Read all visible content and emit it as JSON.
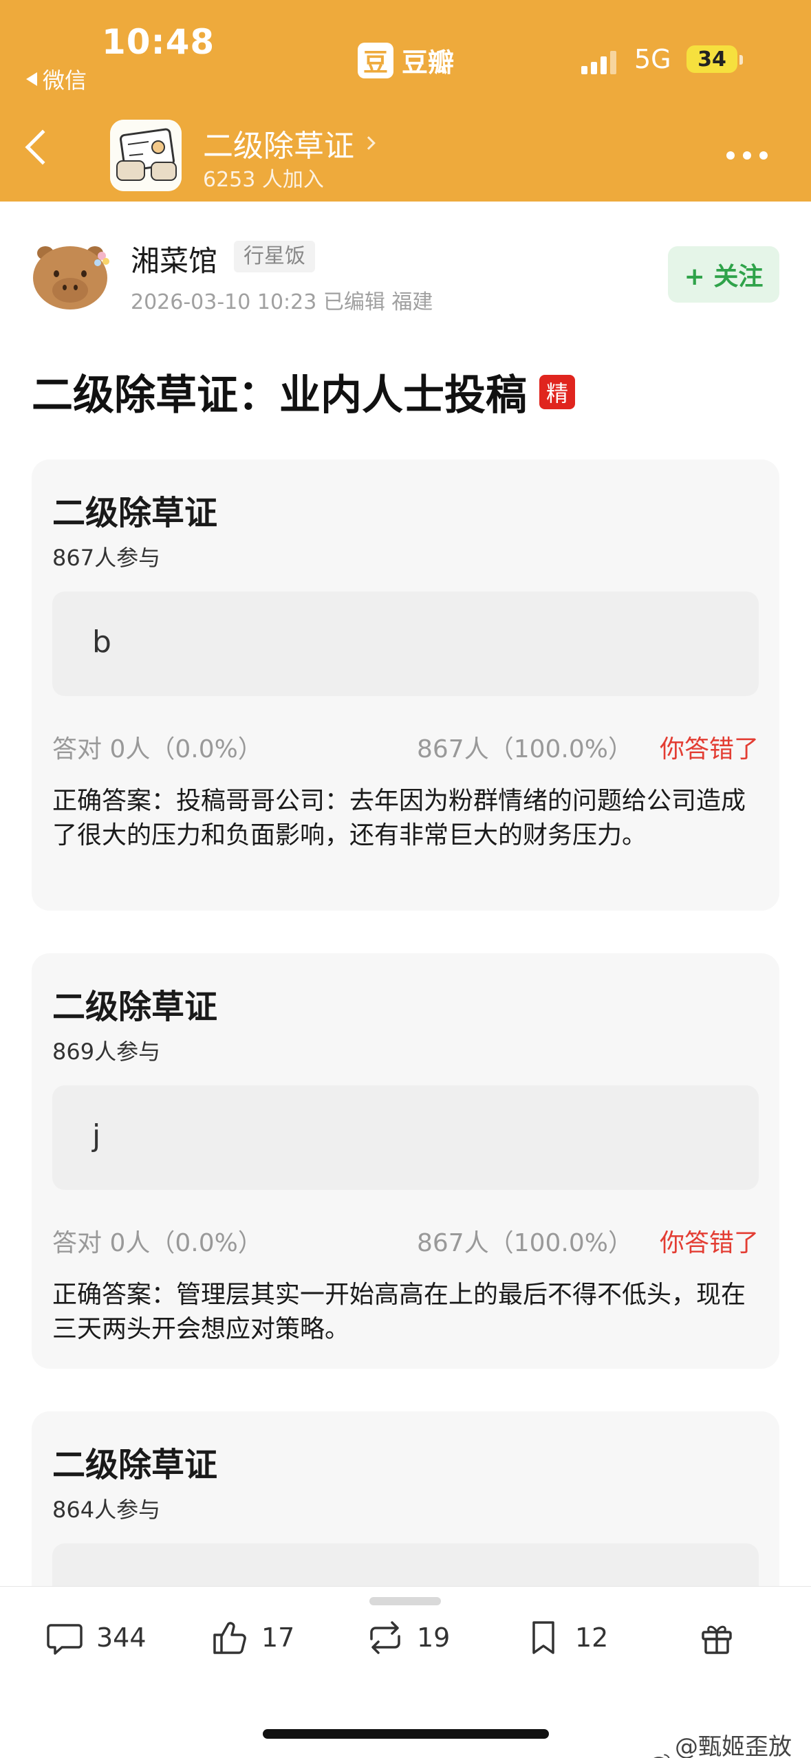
{
  "status_bar": {
    "time": "10:48",
    "back_app": "微信",
    "brand_glyph": "豆",
    "brand_name": "豆瓣",
    "network": "5G",
    "battery": "34"
  },
  "nav": {
    "group_name": "二级除草证",
    "group_members": "6253 人加入"
  },
  "author": {
    "name": "湘菜馆",
    "tag": "行星饭",
    "meta": "2026-03-10 10:23  已编辑  福建",
    "follow_label": "+ 关注"
  },
  "post": {
    "title": "二级除草证：业内人士投稿",
    "badge": "精"
  },
  "quizzes": [
    {
      "title": "二级除草证",
      "participants": "867人参与",
      "answer": "b",
      "correct_stat": "答对  0人（0.0%）",
      "wrong_stat": "867人（100.0%）",
      "result": "你答错了",
      "explanation": "正确答案：投稿哥哥公司：去年因为粉群情绪的问题给公司造成了很大的压力和负面影响，还有非常巨大的财务压力。"
    },
    {
      "title": "二级除草证",
      "participants": "869人参与",
      "answer": "j",
      "correct_stat": "答对  0人（0.0%）",
      "wrong_stat": "867人（100.0%）",
      "result": "你答错了",
      "explanation": "正确答案：管理层其实一开始高高在上的最后不得不低头，现在三天两头开会想应对策略。"
    },
    {
      "title": "二级除草证",
      "participants": "864人参与",
      "answer": "",
      "correct_stat": "",
      "wrong_stat": "",
      "result": "",
      "explanation": ""
    }
  ],
  "actions": {
    "comments": "344",
    "likes": "17",
    "reshares": "19",
    "collects": "12"
  },
  "watermark": "@甄姬歪放瓜",
  "colors": {
    "header_bg": "#eeaa3c",
    "follow_green": "#2fa34a",
    "wrong_red": "#e33d33",
    "badge_red": "#e0251e"
  },
  "icons": [
    "back-icon",
    "chevron-right-icon",
    "more-icon",
    "comment-icon",
    "like-icon",
    "reshare-icon",
    "bookmark-icon",
    "gift-icon",
    "weibo-icon"
  ]
}
